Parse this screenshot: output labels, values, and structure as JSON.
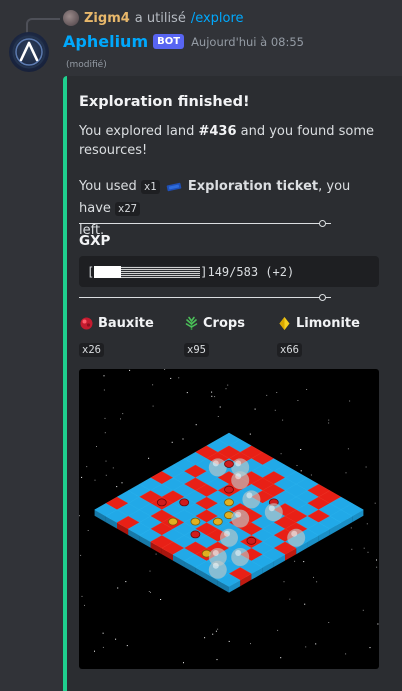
{
  "reply": {
    "user": "Zigm4",
    "action": "a utilisé",
    "command": "/explore"
  },
  "message": {
    "author": "Aphelium",
    "badge": "BOT",
    "timestamp": "Aujourd'hui à 08:55",
    "edited": "(modifié)"
  },
  "embed": {
    "accent_color": "#1fcf8e",
    "title": "Exploration finished!",
    "desc_prefix": "You explored land ",
    "land": "#436",
    "desc_suffix": " and you found some resources!",
    "used_prefix": "You used ",
    "ticket_qty": "x1",
    "ticket_icon": "ticket-icon",
    "ticket_name": "Exploration ticket",
    "have_text": ", you have ",
    "have_qty": "x27",
    "left_text": "left.",
    "gxp_label": "GXP",
    "gxp_bar_open": "[",
    "gxp_bar_close": "]",
    "gxp_progress": 0.256,
    "gxp_value": "149/583 (+2)",
    "resources": [
      {
        "icon": "bauxite-icon",
        "name": "Bauxite",
        "qty": "x26",
        "color": "#e8243f"
      },
      {
        "icon": "crops-icon",
        "name": "Crops",
        "qty": "x95",
        "color": "#3fb950"
      },
      {
        "icon": "limonite-icon",
        "name": "Limonite",
        "qty": "x66",
        "color": "#f5d020"
      }
    ]
  }
}
